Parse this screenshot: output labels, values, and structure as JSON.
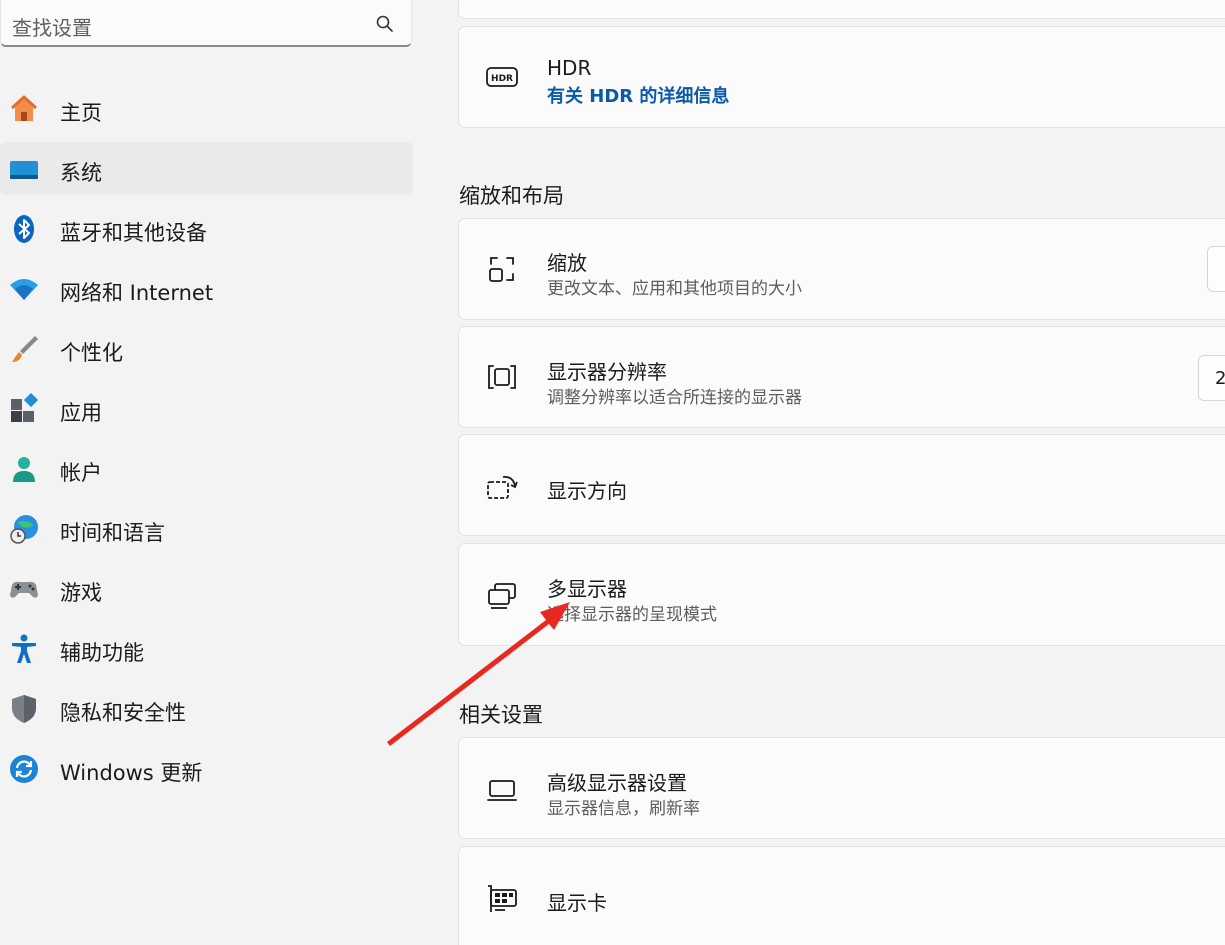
{
  "search": {
    "placeholder": "查找设置"
  },
  "sidebar": {
    "items": [
      {
        "label": "主页"
      },
      {
        "label": "系统"
      },
      {
        "label": "蓝牙和其他设备"
      },
      {
        "label": "网络和 Internet"
      },
      {
        "label": "个性化"
      },
      {
        "label": "应用"
      },
      {
        "label": "帐户"
      },
      {
        "label": "时间和语言"
      },
      {
        "label": "游戏"
      },
      {
        "label": "辅助功能"
      },
      {
        "label": "隐私和安全性"
      },
      {
        "label": "Windows 更新"
      }
    ],
    "selected": "系统"
  },
  "hdr": {
    "title": "HDR",
    "link": "有关 HDR 的详细信息"
  },
  "scale_layout": {
    "heading": "缩放和布局",
    "items": [
      {
        "title": "缩放",
        "subtitle": "更改文本、应用和其他项目的大小"
      },
      {
        "title": "显示器分辨率",
        "subtitle": "调整分辨率以适合所连接的显示器",
        "value_partial": "2"
      },
      {
        "title": "显示方向"
      },
      {
        "title": "多显示器",
        "subtitle": "选择显示器的呈现模式"
      }
    ]
  },
  "related": {
    "heading": "相关设置",
    "items": [
      {
        "title": "高级显示器设置",
        "subtitle": "显示器信息，刷新率"
      },
      {
        "title": "显示卡"
      }
    ]
  },
  "colors": {
    "accent": "#0a5aa8",
    "selected_bg": "#eaeaea",
    "annotation_arrow": "#e8291f"
  }
}
